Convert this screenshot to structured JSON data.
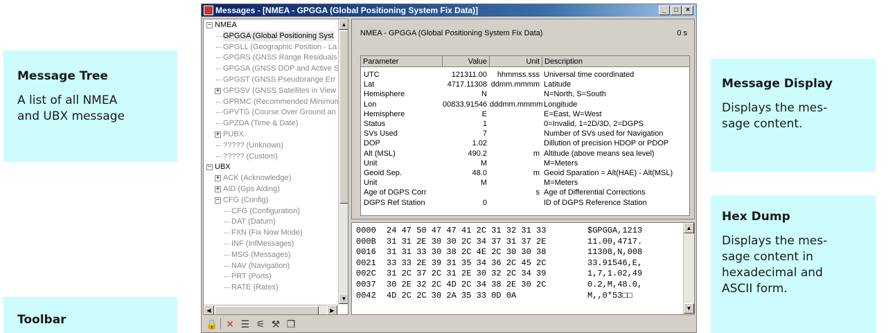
{
  "callouts": {
    "tree": {
      "title": "Message Tree",
      "desc_lines": [
        "A list of all NMEA",
        "and UBX message"
      ]
    },
    "toolbar": {
      "title": "Toolbar"
    },
    "display": {
      "title": "Message Display",
      "desc_lines": [
        "Displays the mes-",
        "sage content."
      ]
    },
    "hex": {
      "title": "Hex Dump",
      "desc_lines": [
        "Displays the mes-",
        "sage content in",
        "hexadecimal and",
        "ASCII form."
      ]
    }
  },
  "window": {
    "title": "Messages - [NMEA - GPGGA (Global Positioning System Fix Data)]",
    "buttons": {
      "minimize": "_",
      "maximize": "□",
      "close": "×"
    }
  },
  "tree": {
    "nodes": [
      {
        "label": "NMEA",
        "box": "−"
      },
      {
        "label": "GPGGA (Global Positioning Syst",
        "selected": true
      },
      {
        "label": "GPGLL (Geographic Position - La"
      },
      {
        "label": "GPGRS (GNSS Range Residuals"
      },
      {
        "label": "GPGSA (GNSS DOP and Active S"
      },
      {
        "label": "GPGST (GNSS Pseudorange Err"
      },
      {
        "label": "GPGSV (GNSS Satellites in View",
        "box": "+"
      },
      {
        "label": "GPRMC (Recommended Minimum"
      },
      {
        "label": "GPVTG (Course Over Ground an"
      },
      {
        "label": "GPZDA (Time & Date)"
      },
      {
        "label": "PUBX",
        "box": "+"
      },
      {
        "label": "????? (Unknown)"
      },
      {
        "label": "????? (Custom)"
      },
      {
        "label": "UBX",
        "box": "−"
      },
      {
        "label": "ACK (Acknowledge)",
        "box": "+"
      },
      {
        "label": "AID (Gps Aiding)",
        "box": "+"
      },
      {
        "label": "CFG (Config)",
        "box": "−"
      },
      {
        "label": "CFG (Configuration)"
      },
      {
        "label": "DAT (Datum)"
      },
      {
        "label": "FXN (Fix Now Mode)"
      },
      {
        "label": "INF (InfMessages)"
      },
      {
        "label": "MSG (Messages)"
      },
      {
        "label": "NAV (Navigation)"
      },
      {
        "label": "PRT (Ports)"
      },
      {
        "label": "RATE (Rates)"
      }
    ]
  },
  "message": {
    "title": "NMEA - GPGGA (Global Positioning System Fix Data)",
    "age": "0 s",
    "headers": [
      "Parameter",
      "Value",
      "Unit",
      "Description"
    ],
    "rows": [
      [
        "UTC",
        "121311.00",
        "hhmmss.sss",
        "Universal time coordinated"
      ],
      [
        "Lat",
        "4717.11308",
        "ddmm.mmmm",
        "Latitude"
      ],
      [
        "Hemisphere",
        "N",
        "",
        "N=North, S=South"
      ],
      [
        "Lon",
        "00833.91546",
        "dddmm.mmmm",
        "Longitude"
      ],
      [
        "Hemisphere",
        "E",
        "",
        "E=East, W=West"
      ],
      [
        "Status",
        "1",
        "",
        "0=Invalid, 1=2D/3D, 2=DGPS"
      ],
      [
        "SVs Used",
        "7",
        "",
        "Number of SVs used for Navigation"
      ],
      [
        "DOP",
        "1.02",
        "",
        "Dillution of precision HDOP or PDOP"
      ],
      [
        "Alt (MSL)",
        "490.2",
        "m",
        "Altitude (above means sea level)"
      ],
      [
        "Unit",
        "M",
        "",
        "M=Meters"
      ],
      [
        "Geoid Sep.",
        "48.0",
        "m",
        "Geoid Sparation = Alt(HAE) - Alt(MSL)"
      ],
      [
        "Unit",
        "M",
        "",
        "M=Meters"
      ],
      [
        "Age of DGPS Corr",
        "",
        "s",
        "Age of Differential Corrections"
      ],
      [
        "DGPS Ref Station",
        "0",
        "",
        "ID of DGPS Reference Station"
      ]
    ]
  },
  "hex": {
    "rows": [
      {
        "offset": "0000",
        "bytes": "24 47 50 47 47 41 2C 31 32 31 33",
        "ascii": "$GPGGA,1213"
      },
      {
        "offset": "000B",
        "bytes": "31 31 2E 30 30 2C 34 37 31 37 2E",
        "ascii": "11.00,4717."
      },
      {
        "offset": "0016",
        "bytes": "31 31 33 30 38 2C 4E 2C 30 30 38",
        "ascii": "11308,N,008"
      },
      {
        "offset": "0021",
        "bytes": "33 33 2E 39 31 35 34 36 2C 45 2C",
        "ascii": "33.91546,E,"
      },
      {
        "offset": "002C",
        "bytes": "31 2C 37 2C 31 2E 30 32 2C 34 39",
        "ascii": "1,7,1.02,49"
      },
      {
        "offset": "0037",
        "bytes": "30 2E 32 2C 4D 2C 34 38 2E 30 2C",
        "ascii": "0.2,M,48.0,"
      },
      {
        "offset": "0042",
        "bytes": "4D 2C 2C 30 2A 35 33 0D 0A",
        "ascii": "M,,0*53□□"
      }
    ]
  },
  "toolbar": {
    "tools": [
      {
        "name": "lock-icon",
        "glyph": "🔒"
      },
      {
        "name": "delete-icon",
        "glyph": "✕"
      },
      {
        "name": "list-icon",
        "glyph": "☰"
      },
      {
        "name": "tree-view-icon",
        "glyph": "⚟"
      },
      {
        "name": "settings-icon",
        "glyph": "⚒"
      },
      {
        "name": "copy-icon",
        "glyph": "❐"
      }
    ]
  }
}
